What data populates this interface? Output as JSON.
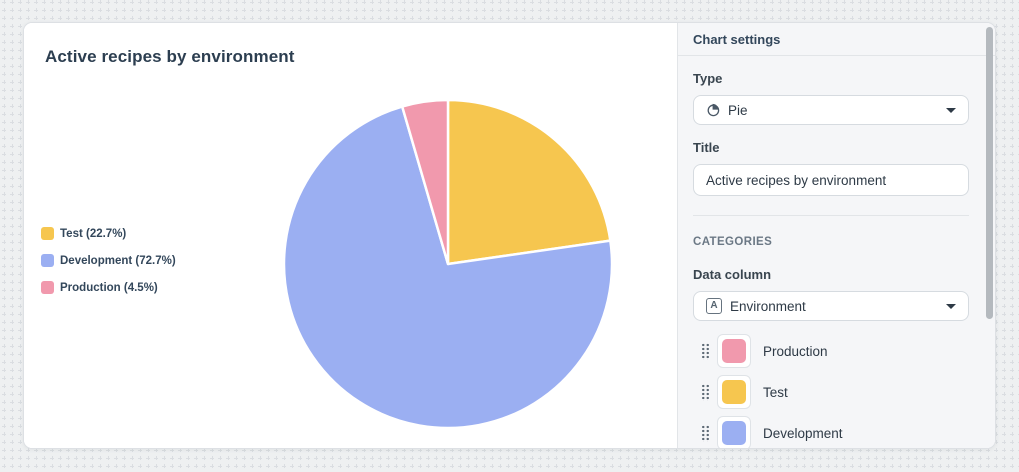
{
  "chart": {
    "title": "Active recipes by environment"
  },
  "chart_data": {
    "type": "pie",
    "title": "Active recipes by environment",
    "legend_position": "left",
    "start_angle_deg": 0,
    "direction": "clockwise",
    "series": [
      {
        "name": "Test",
        "value": 22.7,
        "legend_label": "Test (22.7%)",
        "color": "#f6c64f"
      },
      {
        "name": "Development",
        "value": 72.7,
        "legend_label": "Development (72.7%)",
        "color": "#9bafF2"
      },
      {
        "name": "Production",
        "value": 4.5,
        "legend_label": "Production (4.5%)",
        "color": "#f199ad"
      }
    ]
  },
  "settings": {
    "header": "Chart settings",
    "type_label": "Type",
    "type_value": "Pie",
    "title_label": "Title",
    "title_value": "Active recipes by environment",
    "categories_section_label": "CATEGORIES",
    "data_column_label": "Data column",
    "data_column_value": "Environment",
    "categories": [
      {
        "label": "Production",
        "color": "#f199ad"
      },
      {
        "label": "Test",
        "color": "#f6c64f"
      },
      {
        "label": "Development",
        "color": "#9bafF2"
      }
    ]
  }
}
